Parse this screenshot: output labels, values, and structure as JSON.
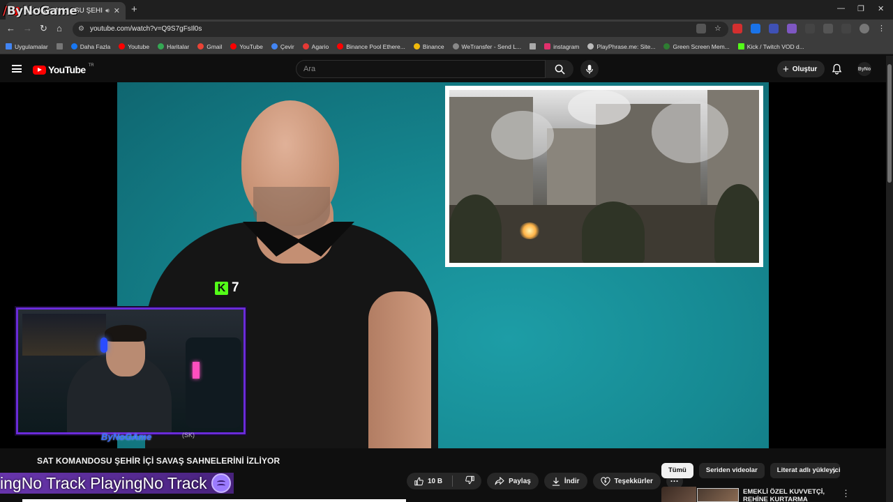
{
  "browser": {
    "tab_title": "SAT KOMANDOSU ŞEHİR İÇİ SAVAŞ SAHNELERİNİ İZLİYOR - YouTube",
    "tab_title_visible": "SAT KOMANDOSU ŞEHİR İÇ",
    "url": "youtube.com/watch?v=Q9S7gFsIl0s",
    "bookmarks": [
      {
        "label": "Uygulamalar",
        "color": "#4285f4"
      },
      {
        "label": "Daha Fazla",
        "color": "#1877f2"
      },
      {
        "label": "Youtube",
        "color": "#ff0000"
      },
      {
        "label": "Haritalar",
        "color": "#34a853"
      },
      {
        "label": "Gmail",
        "color": "#ea4335"
      },
      {
        "label": "YouTube",
        "color": "#ff0000"
      },
      {
        "label": "Çevir",
        "color": "#4285f4"
      },
      {
        "label": "Agario",
        "color": "#e53935"
      },
      {
        "label": "Binance Pool Ethere...",
        "color": "#ff0000"
      },
      {
        "label": "Binance",
        "color": "#f0b90b"
      },
      {
        "label": "WeTransfer - Send L...",
        "color": "#888888"
      },
      {
        "label": "instagram",
        "color": "#e1306c"
      },
      {
        "label": "PlayPhrase.me: Site...",
        "color": "#bbbbbb"
      },
      {
        "label": "Green Screen Mem...",
        "color": "#2e7d32"
      },
      {
        "label": "Kick / Twitch VOD d...",
        "color": "#53fc18"
      }
    ]
  },
  "overlay": {
    "logo_slash": "/",
    "logo_text": "ByNoGame",
    "streamer_name": "ByNoGAme",
    "streamer_tag": "(SK)",
    "now_playing": "ingNo Track PlayingNo Track"
  },
  "youtube": {
    "logo": "YouTube",
    "region": "TR",
    "search_placeholder": "Ara",
    "create_label": "Oluştur",
    "avatar_text": "ByNo",
    "kick_count": "7",
    "video_title": "SAT KOMANDOSU ŞEHİR İÇİ SAVAŞ SAHNELERİNİ İZLİYOR",
    "like_count": "10 B",
    "share_label": "Paylaş",
    "download_label": "İndir",
    "thanks_label": "Teşekkürler",
    "chips": [
      "Tümü",
      "Seriden videolar",
      "Literat adlı yükleyicid"
    ],
    "recommendation_title_1": "EMEKLİ ÖZEL KUVVETÇİ,",
    "recommendation_title_2": "REHİNE KURTARMA"
  },
  "colors": {
    "yt_red": "#ff0000",
    "kick_green": "#53fc18",
    "cam_border": "#6a2bd9",
    "spotify_purple": "#9b7bff"
  }
}
